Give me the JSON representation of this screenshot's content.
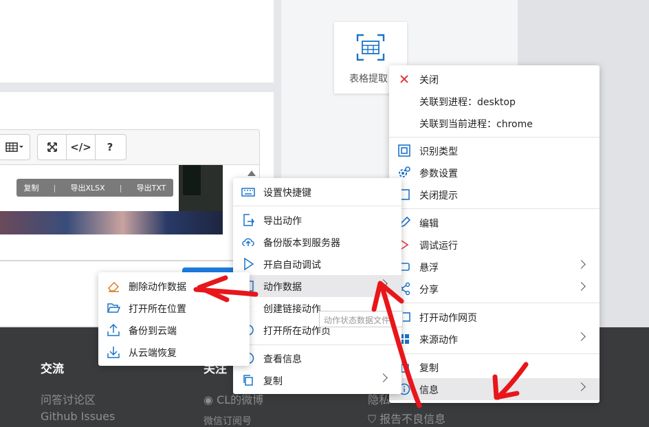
{
  "editor": {
    "toolbar": {
      "table_icon": "table-icon",
      "fullscreen_icon": "expand-icon",
      "code_label": "</>",
      "help_label": "?"
    },
    "copybar": {
      "copy": "复制",
      "export_xlsx": "导出XLSX",
      "export_txt": "导出TXT",
      "sep": "|"
    }
  },
  "tile": {
    "label": "表格提取"
  },
  "footer": {
    "col1_title": "交流",
    "col1_links": [
      "问答讨论区",
      "Github Issues"
    ],
    "col2_title": "关注",
    "col2_links": [
      "CL的微博",
      "微信订阅号"
    ],
    "col3_links": [
      "隐私",
      "报告不良信息"
    ]
  },
  "menu_right": {
    "items": [
      {
        "label": "关闭",
        "icon": "close-icon"
      },
      {
        "label": "关联到进程：desktop",
        "icon": ""
      },
      {
        "label": "关联到当前进程：chrome",
        "icon": ""
      },
      {
        "label": "识别类型",
        "icon": "recognize-icon"
      },
      {
        "label": "参数设置",
        "icon": "gear-icon"
      },
      {
        "label": "关闭提示",
        "icon": "hint-icon"
      },
      {
        "label": "编辑",
        "icon": "edit-icon"
      },
      {
        "label": "调试运行",
        "icon": "play-icon"
      },
      {
        "label": "悬浮",
        "icon": "float-icon"
      },
      {
        "label": "分享",
        "icon": "share-icon"
      },
      {
        "label": "打开动作网页",
        "icon": "web-icon"
      },
      {
        "label": "来源动作",
        "icon": "windows-icon"
      },
      {
        "label": "复制",
        "icon": "copy-icon"
      },
      {
        "label": "信息",
        "icon": "info-icon"
      }
    ]
  },
  "menu_mid": {
    "items": [
      {
        "label": "设置快捷键",
        "icon": "keyboard-icon"
      },
      {
        "label": "导出动作",
        "icon": "export-icon"
      },
      {
        "label": "备份版本到服务器",
        "icon": "cloud-upload-icon"
      },
      {
        "label": "开启自动调试",
        "icon": "play-outline-icon"
      },
      {
        "label": "动作数据",
        "icon": "data-icon"
      },
      {
        "label": "创建链接动作",
        "icon": "link-icon"
      },
      {
        "label": "打开所在动作页",
        "icon": "open-page-icon"
      },
      {
        "label": "查看信息",
        "icon": "info-icon"
      },
      {
        "label": "复制",
        "icon": "copy-icon"
      }
    ]
  },
  "menu_left": {
    "items": [
      {
        "label": "删除动作数据",
        "icon": "eraser-icon"
      },
      {
        "label": "打开所在位置",
        "icon": "folder-open-icon"
      },
      {
        "label": "备份到云端",
        "icon": "upload-icon"
      },
      {
        "label": "从云端恢复",
        "icon": "download-icon"
      }
    ]
  },
  "tooltip": {
    "text": "动作状态数据文件"
  },
  "colors": {
    "accent": "#1d7de3",
    "annotation": "#e8161a",
    "close": "#e0393e",
    "icon": "#1a73c9"
  }
}
